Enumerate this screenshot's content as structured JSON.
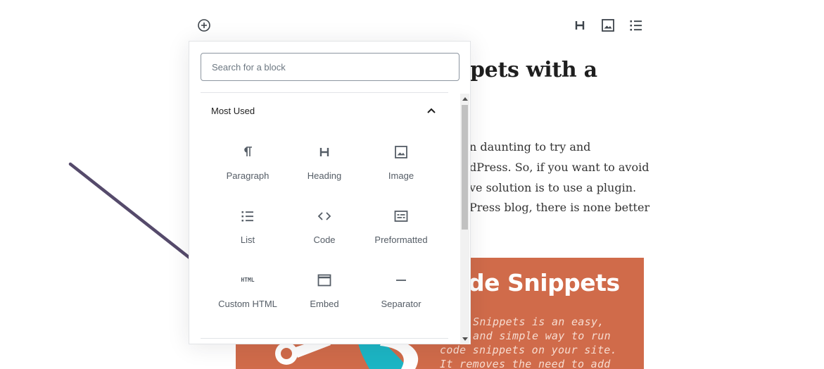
{
  "toolbar": {
    "add_icon": "plus-circle-icon",
    "heading_icon": "heading-icon",
    "image_icon": "image-icon",
    "list_icon": "list-icon"
  },
  "post": {
    "title_fragment": "pets with a",
    "paragraph_lines": [
      "n daunting to try and",
      "dPress. So, if you want to avoid",
      "ve solution is to use a plugin.",
      "Press blog, there is none better"
    ],
    "feature_image": {
      "title_fragment": "de Snippets",
      "desc_lines": [
        "Snippets is an easy,",
        "and simple way to run",
        "code snippets on your site.",
        "It removes the need to add"
      ],
      "colors": {
        "background": "#d06b4a",
        "accent": "#1cb5c4"
      }
    }
  },
  "inserter": {
    "search_placeholder": "Search for a block",
    "panel_title": "Most Used",
    "blocks": [
      {
        "label": "Paragraph",
        "icon": "paragraph-icon"
      },
      {
        "label": "Heading",
        "icon": "heading-icon"
      },
      {
        "label": "Image",
        "icon": "image-icon"
      },
      {
        "label": "List",
        "icon": "list-icon"
      },
      {
        "label": "Code",
        "icon": "code-icon"
      },
      {
        "label": "Preformatted",
        "icon": "preformatted-icon"
      },
      {
        "label": "Custom HTML",
        "icon": "html-icon",
        "icon_text": "HTML"
      },
      {
        "label": "Embed",
        "icon": "embed-icon"
      },
      {
        "label": "Separator",
        "icon": "separator-icon"
      }
    ]
  },
  "annotation": {
    "arrow_color": "#554a6b"
  }
}
